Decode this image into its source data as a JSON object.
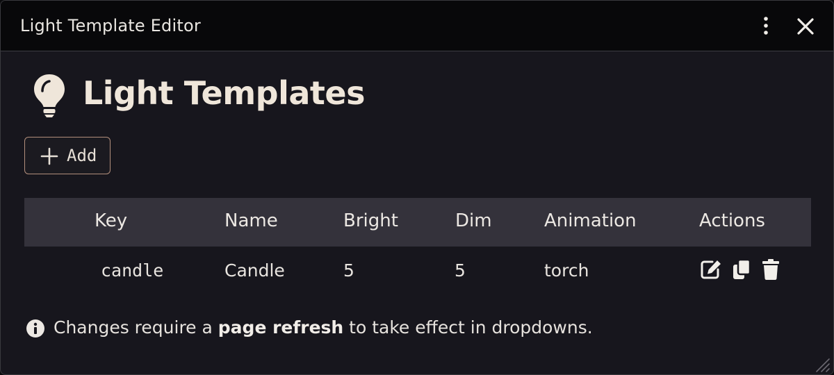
{
  "window": {
    "title": "Light Template Editor"
  },
  "heading": {
    "text": "Light Templates"
  },
  "toolbar": {
    "add_label": "Add"
  },
  "table": {
    "columns": [
      "Key",
      "Name",
      "Bright",
      "Dim",
      "Animation",
      "Actions"
    ],
    "rows": [
      {
        "key": "candle",
        "name": "Candle",
        "bright": "5",
        "dim": "5",
        "animation": "torch"
      }
    ]
  },
  "notice": {
    "prefix": "Changes require a ",
    "emphasis": "page refresh",
    "suffix": " to take effect in dropdowns."
  },
  "icons": {
    "title_menu": "kebab-menu-icon",
    "title_close": "close-icon",
    "heading": "lightbulb-icon",
    "add": "plus-icon",
    "row_actions": [
      "edit-icon",
      "copy-icon",
      "trash-icon"
    ],
    "notice": "info-icon",
    "resize": "resize-handle-icon"
  },
  "colors": {
    "background": "#17161d",
    "titlebar": "#08080a",
    "table_header": "#34323b",
    "accent_border": "#b38f7c",
    "text": "#e8e4df"
  }
}
